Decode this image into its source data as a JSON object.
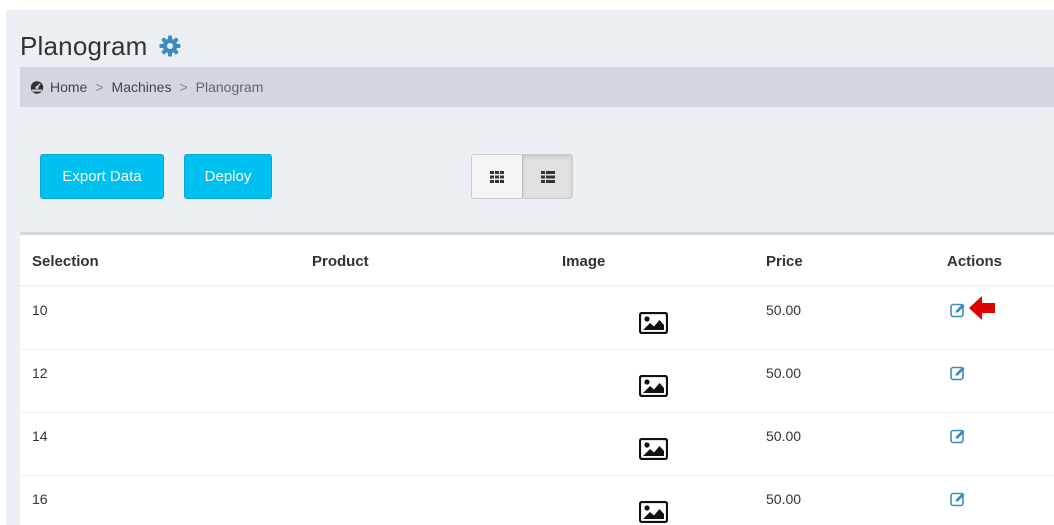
{
  "page": {
    "title": "Planogram"
  },
  "breadcrumb": {
    "items": [
      "Home",
      "Machines",
      "Planogram"
    ],
    "separator": ">"
  },
  "toolbar": {
    "export_label": "Export Data",
    "deploy_label": "Deploy",
    "view_modes": [
      "grid-view-icon",
      "list-view-icon"
    ],
    "active_view": "list"
  },
  "table": {
    "columns": [
      "Selection",
      "Product",
      "Image",
      "Price",
      "Actions"
    ],
    "rows": [
      {
        "selection": "10",
        "product": "",
        "price": "50.00"
      },
      {
        "selection": "12",
        "product": "",
        "price": "50.00"
      },
      {
        "selection": "14",
        "product": "",
        "price": "50.00"
      },
      {
        "selection": "16",
        "product": "",
        "price": "50.00"
      }
    ]
  },
  "colors": {
    "accent": "#00c0ef",
    "page_bg": "#ecf0f5",
    "breadcrumb_bg": "#d2d6de",
    "edit_icon": "#3c8dbc",
    "arrow": "#e00000"
  },
  "icons": {
    "title": "gear-icon",
    "breadcrumb": "dashboard-icon",
    "image": "image-icon",
    "action": "edit-icon",
    "annotation": "red-arrow-icon"
  }
}
